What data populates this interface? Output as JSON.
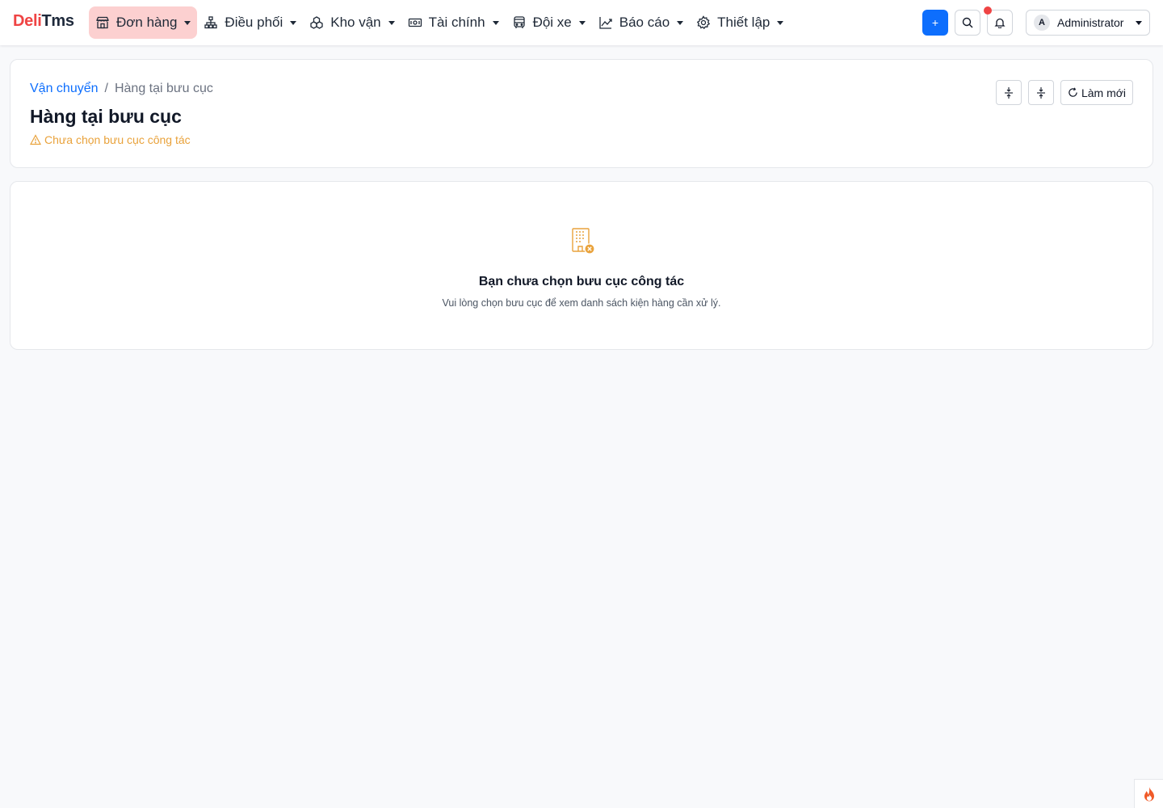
{
  "brand": {
    "part1": "Deli",
    "part2": "Tms"
  },
  "nav": {
    "items": [
      {
        "label": "Đơn hàng",
        "icon": "store-icon",
        "active": true
      },
      {
        "label": "Điều phối",
        "icon": "sitemap-icon"
      },
      {
        "label": "Kho vận",
        "icon": "boxes-icon"
      },
      {
        "label": "Tài chính",
        "icon": "cash-icon"
      },
      {
        "label": "Đội xe",
        "icon": "bus-icon"
      },
      {
        "label": "Báo cáo",
        "icon": "chart-line-icon"
      },
      {
        "label": "Thiết lập",
        "icon": "gear-icon"
      }
    ]
  },
  "toolbar": {
    "plus_label": "+"
  },
  "user": {
    "initial": "A",
    "name": "Administrator"
  },
  "header": {
    "breadcrumb": {
      "parent": "Vận chuyển",
      "separator": "/",
      "current": "Hàng tại bưu cục"
    },
    "title": "Hàng tại bưu cục",
    "warning": "Chưa chọn bưu cục công tác",
    "refresh_label": "Làm mới"
  },
  "empty_state": {
    "title": "Bạn chưa chọn bưu cục công tác",
    "subtitle": "Vui lòng chọn bưu cục để xem danh sách kiện hàng cần xử lý."
  },
  "colors": {
    "brand_red": "#ef4444",
    "primary": "#0d6efd",
    "warning": "#e9a23b",
    "active_nav_bg": "#fcd0d0"
  }
}
